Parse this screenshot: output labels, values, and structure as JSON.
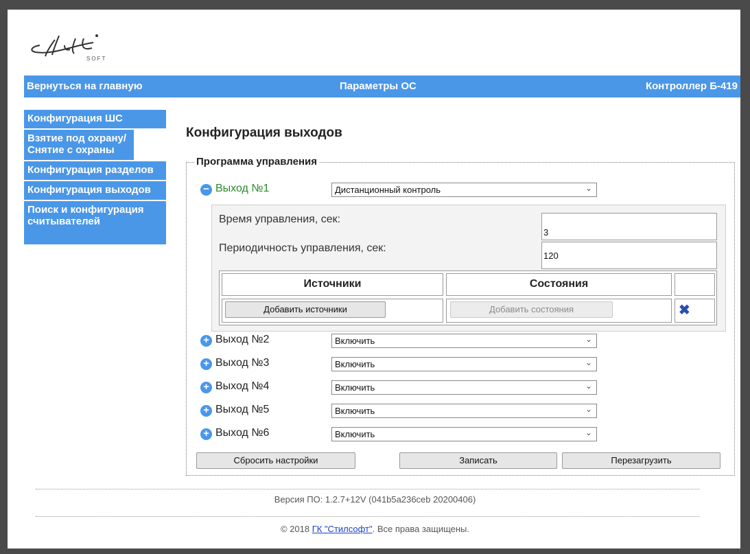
{
  "header": {
    "logo_text": "Stil SOFT",
    "home_link": "Вернуться на главную",
    "center_title": "Параметры ОС",
    "device_title": "Контроллер Б-419"
  },
  "sidebar": {
    "items": [
      {
        "label": "Конфигурация ШС"
      },
      {
        "label": "Взятие под охрану/ Снятие с охраны"
      },
      {
        "label": "Конфигурация разделов"
      },
      {
        "label": "Конфигурация выходов"
      },
      {
        "label": "Поиск и конфигурация считывателей"
      }
    ]
  },
  "main": {
    "title": "Конфигурация выходов",
    "legend": "Программа управления",
    "outputs": [
      {
        "label": "Выход №1",
        "mode": "Дистанционный контроль",
        "expanded": true
      },
      {
        "label": "Выход №2",
        "mode": "Включить",
        "expanded": false
      },
      {
        "label": "Выход №3",
        "mode": "Включить",
        "expanded": false
      },
      {
        "label": "Выход №4",
        "mode": "Включить",
        "expanded": false
      },
      {
        "label": "Выход №5",
        "mode": "Включить",
        "expanded": false
      },
      {
        "label": "Выход №6",
        "mode": "Включить",
        "expanded": false
      }
    ],
    "panel": {
      "control_time_label": "Время управления, сек:",
      "control_time_value": "3",
      "period_label": "Периодичность управления, сек:",
      "period_value": "120",
      "sources_header": "Источники",
      "states_header": "Состояния",
      "add_sources": "Добавить источники",
      "add_states": "Добавить состояния"
    },
    "buttons": {
      "reset": "Сбросить настройки",
      "write": "Записать",
      "reboot": "Перезагрузить"
    }
  },
  "footer": {
    "version": "Версия ПО: 1.2.7+12V (041b5a236ceb 20200406)",
    "copyright_prefix": "© 2018",
    "company_link": "ГК \"Стилсофт\"",
    "copyright_suffix": ". Все права защищены."
  },
  "colors": {
    "accent": "#4a97e8",
    "active_output": "#2a8a2a",
    "delete_icon": "#2a4fb0"
  }
}
